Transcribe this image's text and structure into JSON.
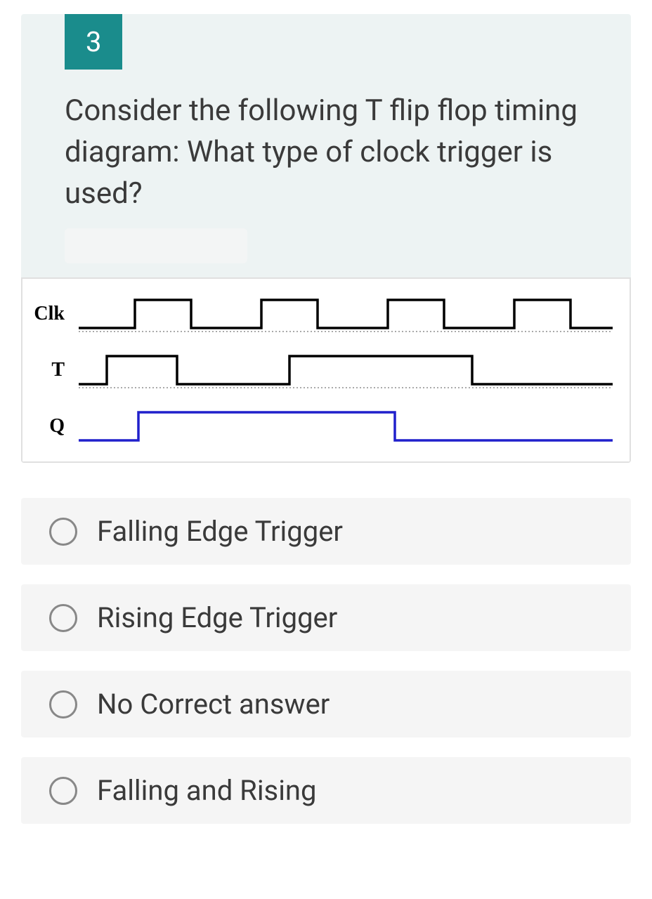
{
  "question": {
    "number": "3",
    "text": "Consider the following T flip flop timing diagram: What type of clock trigger is used?"
  },
  "diagram": {
    "signals": [
      {
        "label": "Clk"
      },
      {
        "label": "T"
      },
      {
        "label": "Q"
      }
    ]
  },
  "options": [
    {
      "label": "Falling Edge Trigger"
    },
    {
      "label": "Rising Edge Trigger"
    },
    {
      "label": "No Correct answer"
    },
    {
      "label": "Falling and Rising"
    }
  ]
}
